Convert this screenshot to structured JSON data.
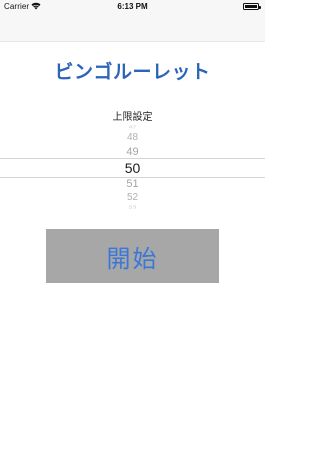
{
  "status_bar": {
    "carrier": "Carrier",
    "time": "6:13 PM",
    "wifi_icon": "wifi-icon",
    "battery_icon": "battery-icon"
  },
  "app": {
    "title": "ビンゴルーレット",
    "title_color": "#2b64b8"
  },
  "upper_limit": {
    "label": "上限設定",
    "picker_values": [
      "47",
      "48",
      "49",
      "50",
      "51",
      "52",
      "53"
    ],
    "selected_value": "50"
  },
  "start_button": {
    "label": "開始",
    "background": "#a7a7a7",
    "text_color": "#3a78d8"
  }
}
